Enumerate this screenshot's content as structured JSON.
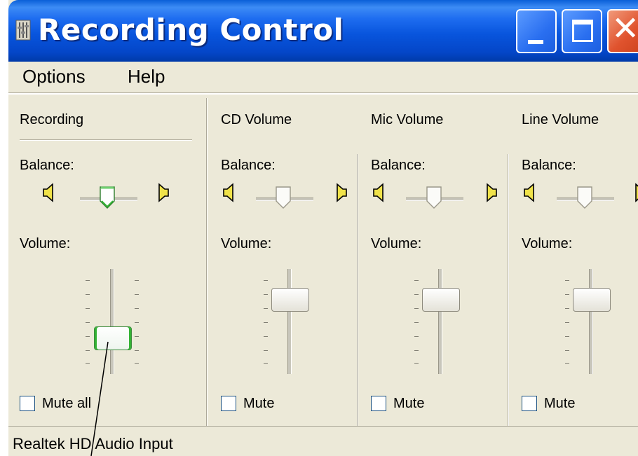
{
  "window": {
    "title": "Recording Control"
  },
  "menu": {
    "items": [
      {
        "label": "Options"
      },
      {
        "label": "Help"
      }
    ]
  },
  "channels": [
    {
      "name": "Recording",
      "balance_label": "Balance:",
      "volume_label": "Volume:",
      "mute_label": "Mute all",
      "active": true,
      "mute_checked": false
    },
    {
      "name": "CD Volume",
      "balance_label": "Balance:",
      "volume_label": "Volume:",
      "mute_label": "Mute",
      "active": false,
      "mute_checked": false
    },
    {
      "name": "Mic Volume",
      "balance_label": "Balance:",
      "volume_label": "Volume:",
      "mute_label": "Mute",
      "active": false,
      "mute_checked": false
    },
    {
      "name": "Line Volume",
      "balance_label": "Balance:",
      "volume_label": "Volume:",
      "mute_label": "Mute",
      "active": false,
      "mute_checked": false
    }
  ],
  "status": {
    "text": "Realtek HD Audio Input"
  },
  "colors": {
    "titlebar": "#0855dd",
    "face": "#ece9d8",
    "active_accent": "#34b334",
    "close": "#e0532e"
  },
  "icons": {
    "app": "mixer-icon",
    "speaker_left": "speaker-left-icon",
    "speaker_right": "speaker-right-icon"
  }
}
